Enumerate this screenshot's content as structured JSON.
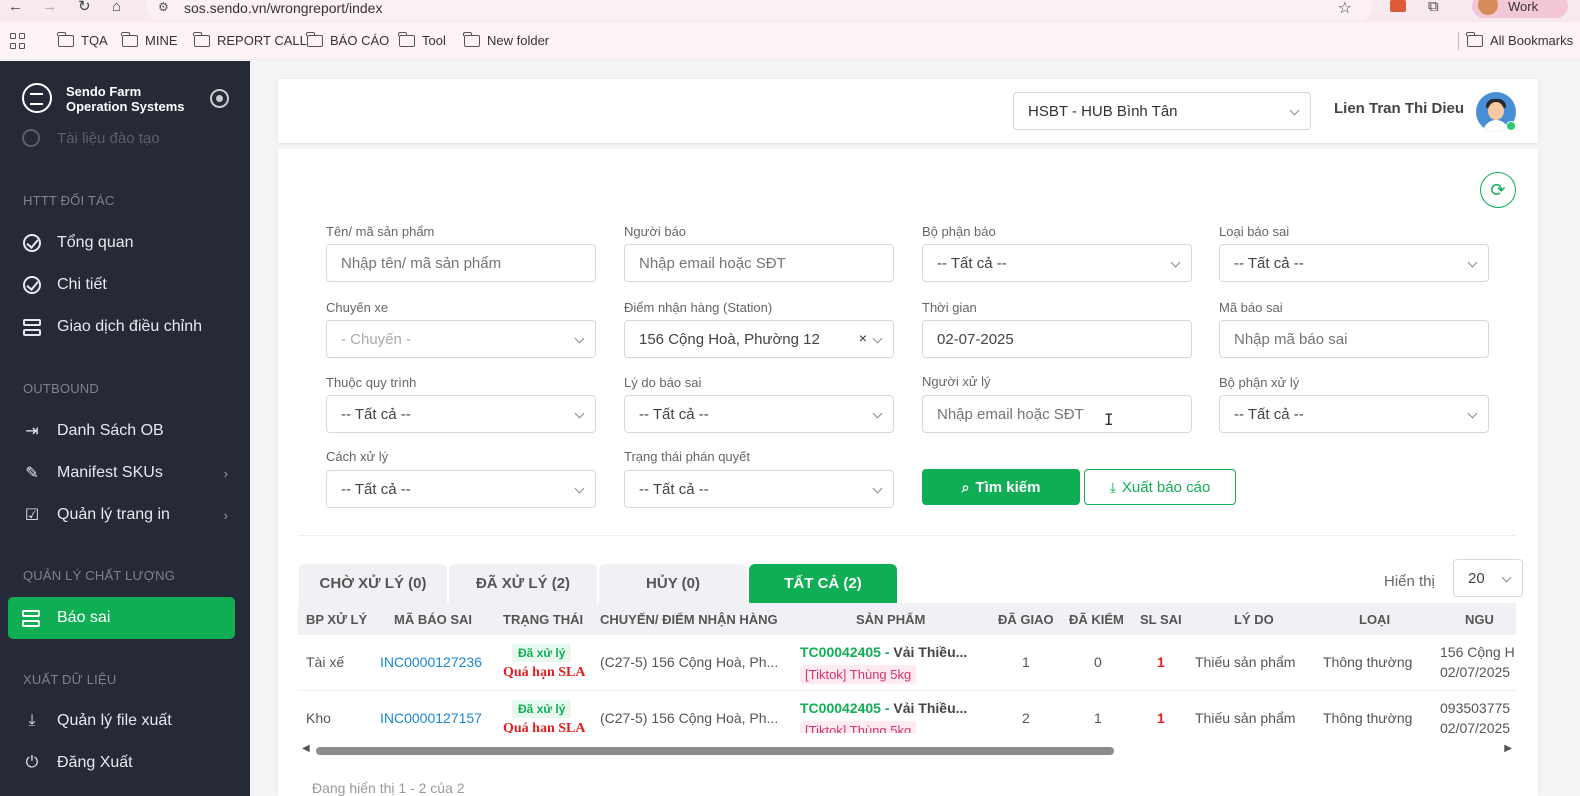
{
  "browser": {
    "url": "sos.sendo.vn/wrongreport/index",
    "profile_label": "Work",
    "bookmarks": [
      "TQA",
      "MINE",
      "REPORT CALL",
      "BÁO CÁO",
      "Tool",
      "New folder"
    ],
    "all_bookmarks": "All Bookmarks"
  },
  "sidebar": {
    "brand_line1": "Sendo Farm",
    "brand_line2": "Operation Systems",
    "faded_item": "Tài liệu đào tạo",
    "sections": {
      "partner": "HTTT ĐỐI TÁC",
      "outbound": "OUTBOUND",
      "quality": "QUẢN LÝ CHẤT LƯỢNG",
      "export": "XUẤT DỮ LIỆU"
    },
    "items": {
      "overview": "Tổng quan",
      "detail": "Chi tiết",
      "adjust": "Giao dịch điều chỉnh",
      "ob_list": "Danh Sách OB",
      "manifest": "Manifest SKUs",
      "print": "Quản lý trang in",
      "wrong_report": "Báo sai",
      "export_files": "Quản lý file xuất",
      "logout": "Đăng Xuất"
    }
  },
  "header": {
    "hub": "HSBT - HUB Bình Tân",
    "user_name": "Lien Tran Thi Dieu"
  },
  "filters": {
    "product": {
      "label": "Tên/ mã sản phẩm",
      "placeholder": "Nhập tên/ mã sản phẩm"
    },
    "reporter": {
      "label": "Người báo",
      "placeholder": "Nhập email hoặc SĐT"
    },
    "report_dept": {
      "label": "Bộ phận báo",
      "value": "-- Tất cả --"
    },
    "report_type": {
      "label": "Loại báo sai",
      "value": "-- Tất cả --"
    },
    "trip": {
      "label": "Chuyến xe",
      "value": "- Chuyến -"
    },
    "station": {
      "label": "Điểm nhận hàng (Station)",
      "value": "156 Cộng Hoà, Phường 12"
    },
    "time": {
      "label": "Thời gian",
      "value": "02-07-2025"
    },
    "report_code": {
      "label": "Mã báo sai",
      "placeholder": "Nhập mã báo sai"
    },
    "process": {
      "label": "Thuộc quy trình",
      "value": "-- Tất cả --"
    },
    "reason": {
      "label": "Lý do báo sai",
      "value": "-- Tất cả --"
    },
    "handler": {
      "label": "Người xử lý",
      "placeholder": "Nhập email hoặc SĐT"
    },
    "handler_dept": {
      "label": "Bộ phận xử lý",
      "value": "-- Tất cả --"
    },
    "handling": {
      "label": "Cách xử lý",
      "value": "-- Tất cả --"
    },
    "verdict": {
      "label": "Trạng thái phán quyết",
      "value": "-- Tất cả --"
    },
    "search_btn": "Tìm kiếm",
    "export_btn": "Xuất báo cáo"
  },
  "tabs": [
    "CHỜ XỬ LÝ (0)",
    "ĐÃ XỬ LÝ (2)",
    "HỦY (0)",
    "TẤT CẢ (2)"
  ],
  "page_size": {
    "label": "Hiển thị",
    "value": "20"
  },
  "table": {
    "columns": [
      "BP XỬ LÝ",
      "MÃ BÁO SAI",
      "TRẠNG THÁI",
      "CHUYẾN/ ĐIỂM NHẬN HÀNG",
      "SẢN PHẨM",
      "ĐÃ GIAO",
      "ĐÃ KIỂM",
      "SL SAI",
      "LÝ DO",
      "LOẠI",
      "NGU"
    ],
    "rows": [
      {
        "dept": "Tài xế",
        "code": "INC0000127236",
        "status": "Đã xử lý",
        "sla": "Quá hạn SLA",
        "trip": "(C27-5) 156 Cộng Hoà, Ph...",
        "product_code": "TC00042405 -",
        "product_name": "Vải Thiều...",
        "tag": "[Tiktok] Thùng 5kg",
        "delivered": "1",
        "checked": "0",
        "wrong_qty": "1",
        "reason": "Thiếu sản phẩm",
        "type": "Thông thường",
        "extra1": "156 Cộng H",
        "extra2": "02/07/2025"
      },
      {
        "dept": "Kho",
        "code": "INC0000127157",
        "status": "Đã xử lý",
        "sla": "Quá hạn SLA",
        "trip": "(C27-5) 156 Cộng Hoà, Ph...",
        "product_code": "TC00042405 -",
        "product_name": "Vải Thiều...",
        "tag": "[Tiktok] Thùng 5kg",
        "delivered": "2",
        "checked": "1",
        "wrong_qty": "1",
        "reason": "Thiếu sản phẩm",
        "type": "Thông thường",
        "extra1": "093503775",
        "extra2": "02/07/2025"
      }
    ]
  },
  "footer": {
    "info": "Đang hiển thị 1 - 2 của 2"
  }
}
